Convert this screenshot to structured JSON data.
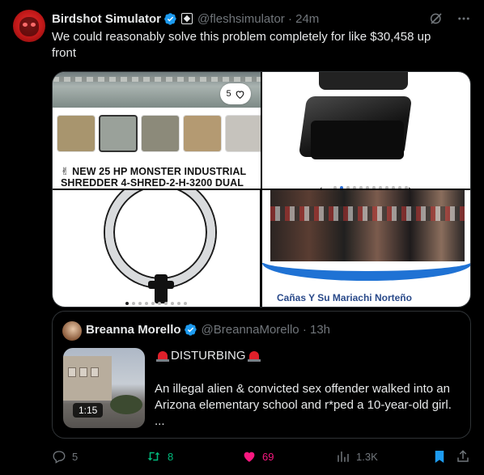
{
  "post": {
    "display_name": "Birdshot Simulator",
    "handle": "@fleshsimulator",
    "time": "24m",
    "text": "We could reasonably solve this problem completely for like $30,458 up front"
  },
  "media": {
    "image1": {
      "like_count": "5",
      "title": "✌ NEW 25 HP MONSTER INDUSTRIAL\nSHREDDER 4-SHRED-2-H-3200 DUAL"
    },
    "image4": {
      "caption": "Cañas Y Su Mariachi Norteño"
    }
  },
  "quote": {
    "display_name": "Breanna Morello",
    "handle": "@BreannaMorello",
    "time": "13h",
    "video_duration": "1:15",
    "title": "DISTURBING",
    "body": "An illegal alien & convicted sex offender walked into an Arizona elementary school and r*ped a 10-year-old girl.\n..."
  },
  "actions": {
    "replies": "5",
    "reposts": "8",
    "likes": "69",
    "views": "1.3K"
  },
  "colors": {
    "background": "#000000",
    "verified_blue": "#1d9bf0",
    "repost_green": "#00ba7c",
    "like_pink": "#f91880",
    "muted": "#71767b"
  },
  "icons": [
    "verified-badge-icon",
    "affiliate-badge-icon",
    "grok-icon",
    "more-icon",
    "heart-outline-icon",
    "reply-icon",
    "repost-icon",
    "like-icon",
    "views-icon",
    "bookmark-icon",
    "share-icon",
    "siren-icon"
  ]
}
